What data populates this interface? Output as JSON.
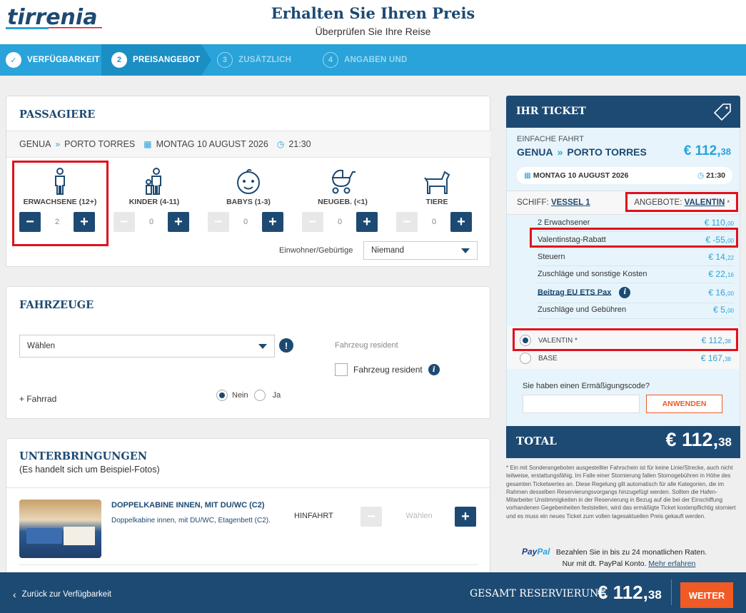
{
  "header": {
    "logo_text": "tirrenia",
    "title": "Erhalten Sie Ihren Preis",
    "subtitle": "Überprüfen Sie Ihre Reise"
  },
  "steps": [
    {
      "num": "✓",
      "label": "VERFÜGBARKEIT",
      "state": "done"
    },
    {
      "num": "2",
      "label": "PREISANGEBOT",
      "state": "current"
    },
    {
      "num": "3",
      "label": "ZUSÄTZLICH",
      "state": "todo"
    },
    {
      "num": "4",
      "label": "ANGABEN UND",
      "state": "todo"
    }
  ],
  "passengers": {
    "title": "PASSAGIERE",
    "from": "GENUA",
    "to": "PORTO TORRES",
    "date": "MONTAG 10 AUGUST 2026",
    "time": "21:30",
    "types": [
      {
        "label": "ERWACHSENE (12+)",
        "count": "2"
      },
      {
        "label": "KINDER (4-11)",
        "count": "0"
      },
      {
        "label": "BABYS (1-3)",
        "count": "0"
      },
      {
        "label": "NEUGEB. (<1)",
        "count": "0"
      },
      {
        "label": "TIERE",
        "count": "0"
      }
    ],
    "resident_label": "Einwohner/Gebürtige",
    "resident_value": "Niemand"
  },
  "vehicles": {
    "title": "FAHRZEUGE",
    "select_value": "Wählen",
    "resident_heading": "Fahrzeug resident",
    "resident_checkbox": "Fahrzeug resident",
    "bike_link": "+ Fahrrad",
    "no_label": "Nein",
    "yes_label": "Ja"
  },
  "accommodation": {
    "title": "UNTERBRINGUNGEN",
    "subtitle": "(Es handelt sich um Beispiel-Fotos)",
    "item_title": "DOPPELKABINE INNEN, MIT DU/WC (C2)",
    "item_desc": "Doppelkabine innen, mit DU/WC, Etagenbett (C2).",
    "direction": "HINFAHRT",
    "select_placeholder": "Wählen"
  },
  "ticket": {
    "title": "IHR TICKET",
    "trip_type": "EINFACHE FAHRT",
    "from": "GENUA",
    "to": "PORTO TORRES",
    "price_main": "€ 112,",
    "price_cents": "38",
    "date": "MONTAG 10 AUGUST 2026",
    "time": "21:30",
    "ship_label": "SCHIFF:",
    "ship_name": "VESSEL 1",
    "offer_label": "ANGEBOTE:",
    "offer_name": "VALENTIN",
    "offer_star": "*",
    "lines": [
      {
        "label": "2 Erwachsener",
        "amount": "€ 110,",
        "cents": "00"
      },
      {
        "label": "Valentinstag-Rabatt",
        "amount": "€ -55,",
        "cents": "00"
      },
      {
        "label": "Steuern",
        "amount": "€ 14,",
        "cents": "22"
      },
      {
        "label": "Zuschläge und sonstige Kosten",
        "amount": "€ 22,",
        "cents": "16"
      },
      {
        "label": "Beitrag EU ETS Pax",
        "amount": "€ 16,",
        "cents": "00"
      },
      {
        "label": "Zuschläge und Gebühren",
        "amount": "€ 5,",
        "cents": "00"
      }
    ],
    "fares": [
      {
        "label": "VALENTIN *",
        "amount": "€ 112,",
        "cents": "38",
        "selected": true
      },
      {
        "label": "BASE",
        "amount": "€ 167,",
        "cents": "38",
        "selected": false
      }
    ],
    "discount_question": "Sie haben einen Ermäßigungscode?",
    "apply_label": "ANWENDEN",
    "total_label": "TOTAL",
    "total_main": "€ 112,",
    "total_cents": "38"
  },
  "disclaimer": "* Ein mit Sonderangeboten ausgestellter Fahrschein ist für keine Linie/Strecke, auch nicht teilweise, erstattungsfähig. Im Falle einer Stornierung fallen Stornogebühren in Höhe des gesamten Ticketwertes an. Diese Regelung gilt automatisch für alle Kategorien, die im Rahmen desselben Reservierungsvorgangs hinzugefügt werden. Sollten die Hafen-Mitarbeiter Unstimmigkeiten in der Reservierung in Bezug auf die bei der Einschiffung vorhandenen Gegebenheiten feststellen, wird das ermäßigte Ticket kostenpflichtig storniert und es muss ein neues Ticket zum vollen tagesaktuellen Preis gekauft werden.",
  "paypal": {
    "brand_a": "Pay",
    "brand_b": "Pal",
    "text1": "Bezahlen Sie in bis zu 24 monatlichen Raten.",
    "text2": "Nur mit dt. PayPal Konto.",
    "link": "Mehr erfahren"
  },
  "footer": {
    "back": "Zurück zur Verfügbarkeit",
    "total_label": "GESAMT RESERVIERUNG",
    "total_main": "€ 112,",
    "total_cents": "38",
    "next": "WEITER"
  },
  "colors": {
    "navy": "#1d4a72",
    "blue": "#29a3d9",
    "orange": "#f15a24",
    "red": "#e0101d"
  }
}
